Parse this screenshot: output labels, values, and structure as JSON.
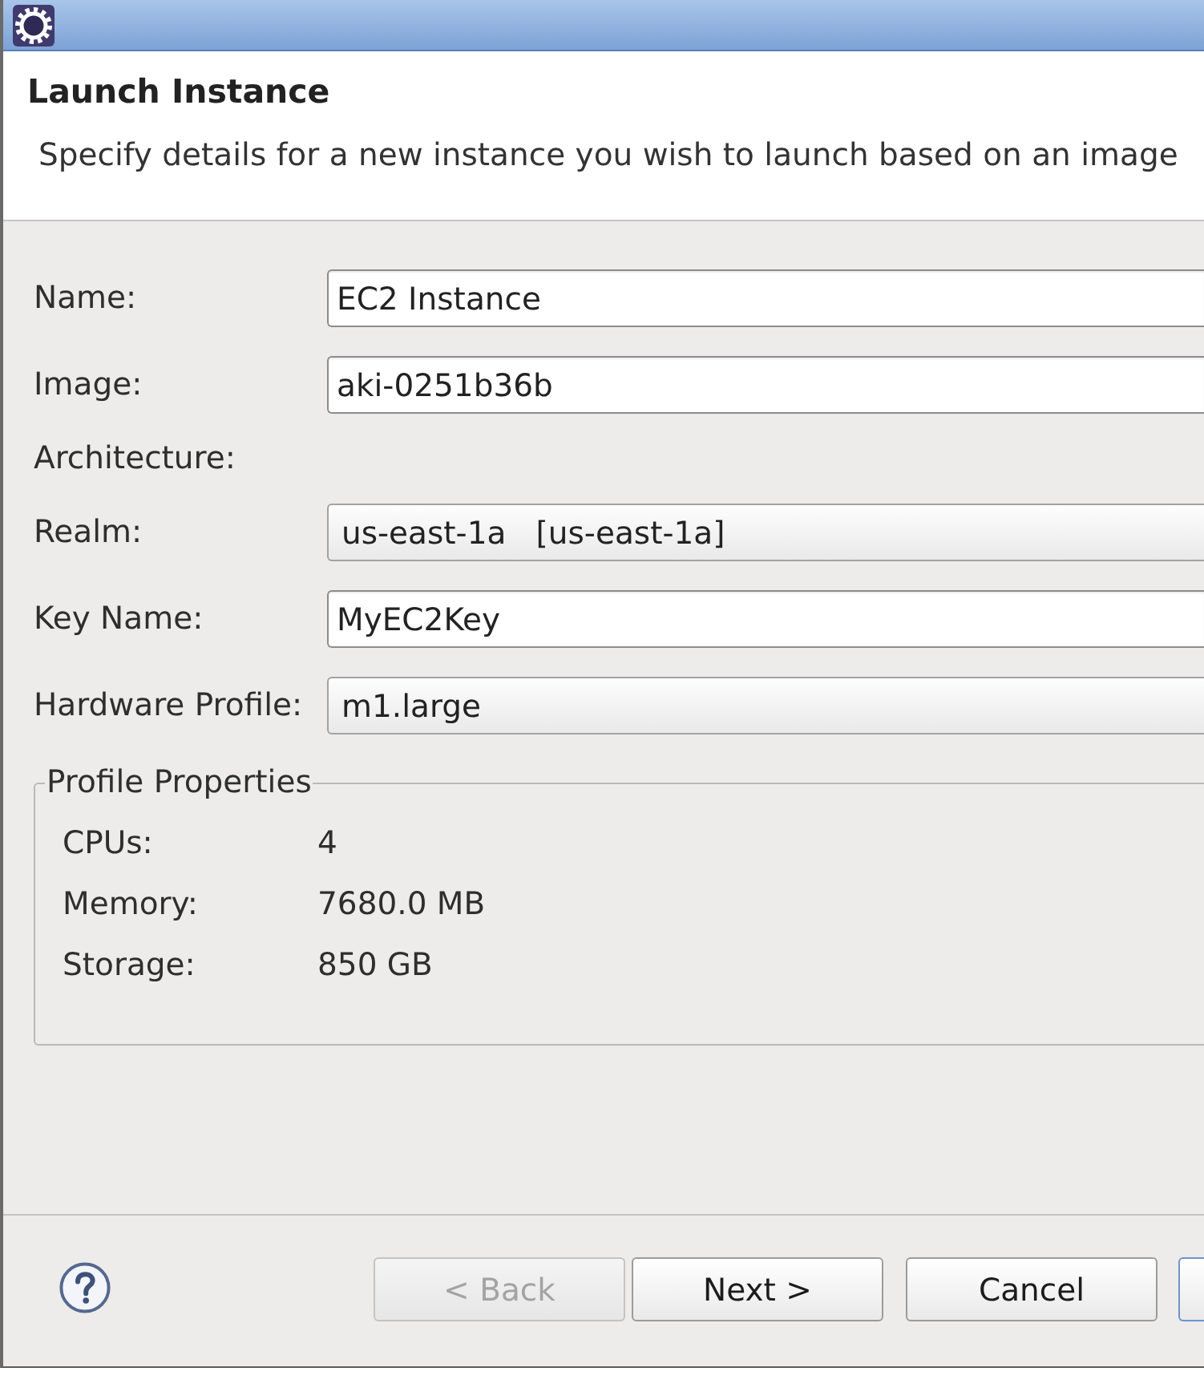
{
  "header": {
    "title": "Launch Instance",
    "description": "Specify details for a new instance you wish to launch based on an image"
  },
  "fields": [
    {
      "label": "Name:",
      "kind": "text",
      "value": "EC2 Instance"
    },
    {
      "label": "Image:",
      "kind": "text",
      "value": "aki-0251b36b"
    },
    {
      "label": "Architecture:",
      "kind": "label"
    },
    {
      "label": "Realm:",
      "kind": "combo",
      "value": "us-east-1a   [us-east-1a]"
    },
    {
      "label": "Key Name:",
      "kind": "text",
      "value": "MyEC2Key"
    },
    {
      "label": "Hardware Profile:",
      "kind": "combo",
      "value": "m1.large"
    }
  ],
  "profile_properties": {
    "title": "Profile Properties",
    "rows": [
      {
        "label": "CPUs:",
        "value": "4"
      },
      {
        "label": "Memory:",
        "value": "7680.0 MB"
      },
      {
        "label": "Storage:",
        "value": "850 GB"
      }
    ]
  },
  "buttons": [
    {
      "label": "< Back",
      "disabled": true,
      "default": false
    },
    {
      "label": "Next >",
      "disabled": false,
      "default": false
    },
    {
      "label": "Cancel",
      "disabled": false,
      "default": false
    },
    {
      "disabled": false,
      "default": true
    }
  ]
}
